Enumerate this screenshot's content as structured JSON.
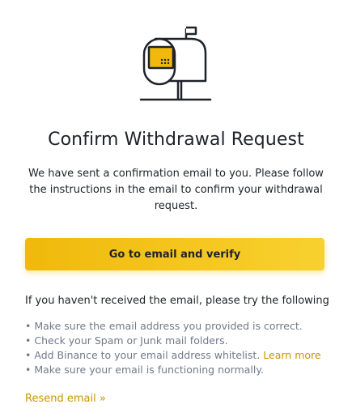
{
  "dialog": {
    "icon": "mailbox-icon",
    "title": "Confirm Withdrawal Request",
    "description": "We have sent a confirmation email to you. Please follow the instructions in the email to confirm your withdrawal request.",
    "primary_button": "Go to email and verify",
    "hint": "If you haven't received the email, please try the following",
    "tips": [
      {
        "bullet": "•",
        "text": "Make sure the email address you provided is correct."
      },
      {
        "bullet": "•",
        "text": "Check your Spam or Junk mail folders."
      },
      {
        "bullet": "•",
        "text": "Add Binance to your email address whitelist.",
        "link": "Learn more"
      },
      {
        "bullet": "•",
        "text": "Make sure your email is functioning normally."
      }
    ],
    "resend_link": "Resend email »"
  },
  "colors": {
    "accent_start": "#f0b90b",
    "accent_end": "#f8d12f",
    "link": "#c99400",
    "text_primary": "#1e2329",
    "text_secondary": "#707a8a"
  }
}
